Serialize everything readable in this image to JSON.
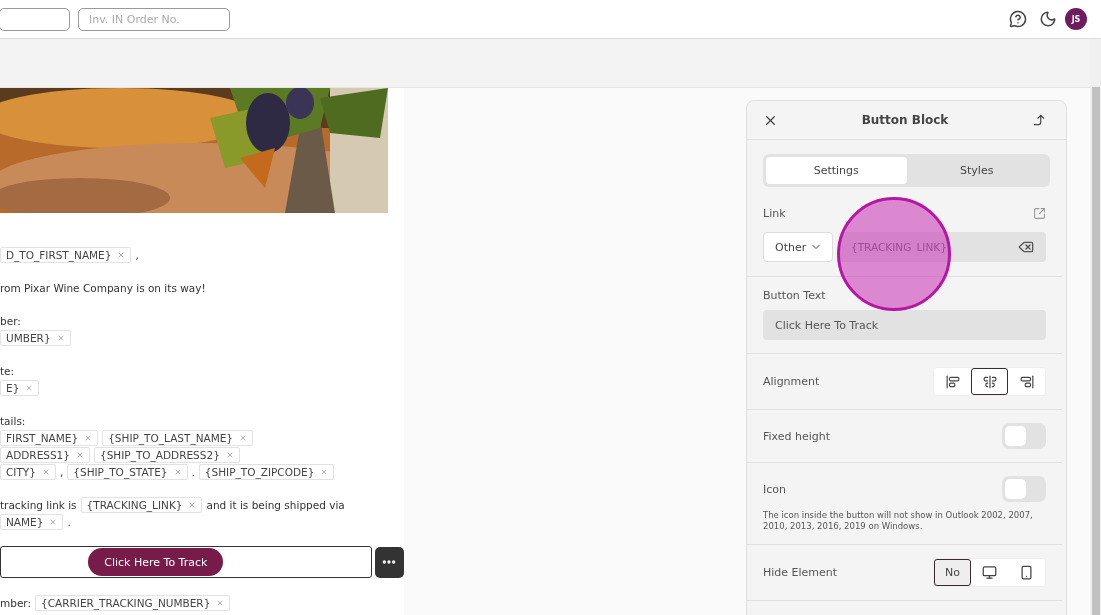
{
  "top_bar": {
    "fields": [
      {
        "kind": "blank"
      },
      {
        "kind": "placeholder",
        "placeholder": "Inv. IN Order No."
      }
    ],
    "user": {
      "initials": "JS"
    }
  },
  "email": {
    "blocks": [
      {
        "kind": "paragraph",
        "lines": [
          [
            {
              "kind": "tag",
              "text": "D_TO_FIRST_NAME}"
            },
            {
              "kind": "text",
              "text": ","
            }
          ]
        ]
      },
      {
        "kind": "paragraph",
        "lines": [
          [
            {
              "kind": "text",
              "text": "rom Pixar Wine Company is on its way!"
            }
          ]
        ]
      },
      {
        "kind": "paragraph",
        "lines": [
          [
            {
              "kind": "text",
              "text": "ber:"
            }
          ],
          [
            {
              "kind": "tag",
              "text": "UMBER}"
            }
          ]
        ]
      },
      {
        "kind": "paragraph",
        "lines": [
          [
            {
              "kind": "text",
              "text": "te:"
            }
          ],
          [
            {
              "kind": "tag",
              "text": "E}"
            }
          ]
        ]
      },
      {
        "kind": "paragraph",
        "lines": [
          [
            {
              "kind": "text",
              "text": "tails:"
            }
          ],
          [
            {
              "kind": "tag",
              "text": "FIRST_NAME}"
            },
            {
              "kind": "tag",
              "text": "{SHIP_TO_LAST_NAME}"
            }
          ],
          [
            {
              "kind": "tag",
              "text": "ADDRESS1}"
            },
            {
              "kind": "tag",
              "text": "{SHIP_TO_ADDRESS2}"
            }
          ],
          [
            {
              "kind": "tag",
              "text": "CITY}"
            },
            {
              "kind": "text",
              "text": ","
            },
            {
              "kind": "tag",
              "text": "{SHIP_TO_STATE}"
            },
            {
              "kind": "text",
              "text": "."
            },
            {
              "kind": "tag",
              "text": "{SHIP_TO_ZIPCODE}"
            }
          ]
        ]
      },
      {
        "kind": "paragraph",
        "lines": [
          [
            {
              "kind": "text",
              "text": "tracking link is"
            },
            {
              "kind": "tag",
              "text": "{TRACKING_LINK}"
            },
            {
              "kind": "text",
              "text": "and it is being shipped via"
            }
          ],
          [
            {
              "kind": "tag",
              "text": "NAME}"
            },
            {
              "kind": "text",
              "text": "."
            }
          ]
        ]
      },
      {
        "kind": "button",
        "label": "Click Here To Track"
      },
      {
        "kind": "paragraph",
        "lines": [
          [
            {
              "kind": "text",
              "text": "mber:"
            },
            {
              "kind": "tag",
              "text": "{CARRIER_TRACKING_NUMBER}"
            }
          ]
        ]
      }
    ]
  },
  "panel": {
    "title": "Button Block",
    "tabs": [
      {
        "label": "Settings",
        "selected": true
      },
      {
        "label": "Styles",
        "selected": false
      }
    ],
    "link": {
      "label": "Link",
      "type": "Other",
      "value": "{TRACKING_LINK}"
    },
    "button_text": {
      "label": "Button Text",
      "value": "Click Here To Track"
    },
    "alignment": {
      "label": "Alignment",
      "options": [
        {
          "kind": "left",
          "selected": false
        },
        {
          "kind": "center",
          "selected": true
        },
        {
          "kind": "right",
          "selected": false
        }
      ]
    },
    "fixed_height": {
      "label": "Fixed height",
      "on": false
    },
    "icon": {
      "label": "Icon",
      "on": false,
      "note": "The icon inside the button will not show in Outlook 2002, 2007, 2010, 2013, 2016, 2019 on Windows."
    },
    "hide_element": {
      "label": "Hide Element",
      "options": [
        {
          "kind": "text",
          "label": "No",
          "selected": true
        },
        {
          "kind": "desktop",
          "selected": false
        },
        {
          "kind": "mobile",
          "selected": false
        }
      ]
    }
  },
  "click_highlight": {
    "kind": "circle"
  }
}
